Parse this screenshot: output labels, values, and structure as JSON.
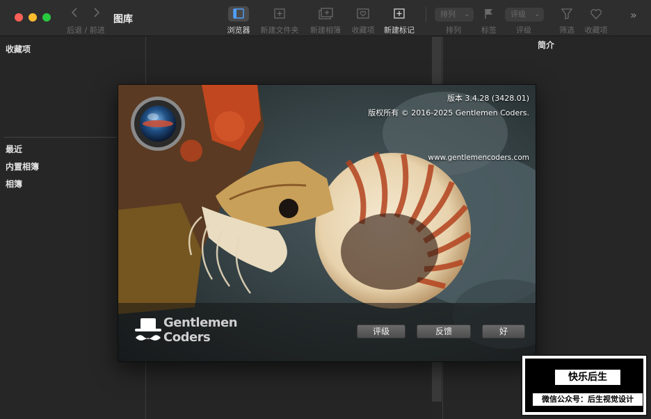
{
  "window": {
    "title": "图库",
    "nav_label": "后退 / 前进"
  },
  "toolbar": {
    "tools": [
      {
        "label": "浏览器",
        "icon": "browser-icon",
        "active": true
      },
      {
        "label": "新建文件夹",
        "icon": "new-folder-icon"
      },
      {
        "label": "新建相簿",
        "icon": "new-album-icon"
      },
      {
        "label": "收藏项",
        "icon": "favorite-folder-icon"
      },
      {
        "label": "新建标记",
        "icon": "new-marker-icon"
      }
    ],
    "sort": {
      "value": "排列",
      "label": "排列"
    },
    "tag": {
      "label": "标签",
      "icon": "flag-icon"
    },
    "rating": {
      "value": "评级",
      "label": "评级"
    },
    "filter": {
      "label": "筛选",
      "icon": "funnel-icon"
    },
    "favorites": {
      "label": "收藏项",
      "icon": "heart-icon"
    },
    "more_icon": "double-chevron-right-icon"
  },
  "sidebar": {
    "favorites_header": "收藏项",
    "items": [
      "最近",
      "内置相簿",
      "相簿"
    ]
  },
  "info_panel": {
    "title": "简介"
  },
  "about": {
    "version": "版本 3.4.28 (3428.01)",
    "copyright": "版权所有 © 2016-2025 Gentlemen Coders.",
    "website": "www.gentlemencoders.com",
    "brand_line1": "Gentlemen",
    "brand_line2": "Coders",
    "buttons": {
      "rate": "评级",
      "feedback": "反馈",
      "ok": "好"
    }
  },
  "watermark": {
    "title": "快乐后生",
    "subtitle": "微信公众号：后生视觉设计"
  },
  "colors": {
    "background": "#262626",
    "toolbar": "#2e2e2e",
    "close": "#fe5f57",
    "minimize": "#febc2e",
    "maximize": "#28c840"
  }
}
